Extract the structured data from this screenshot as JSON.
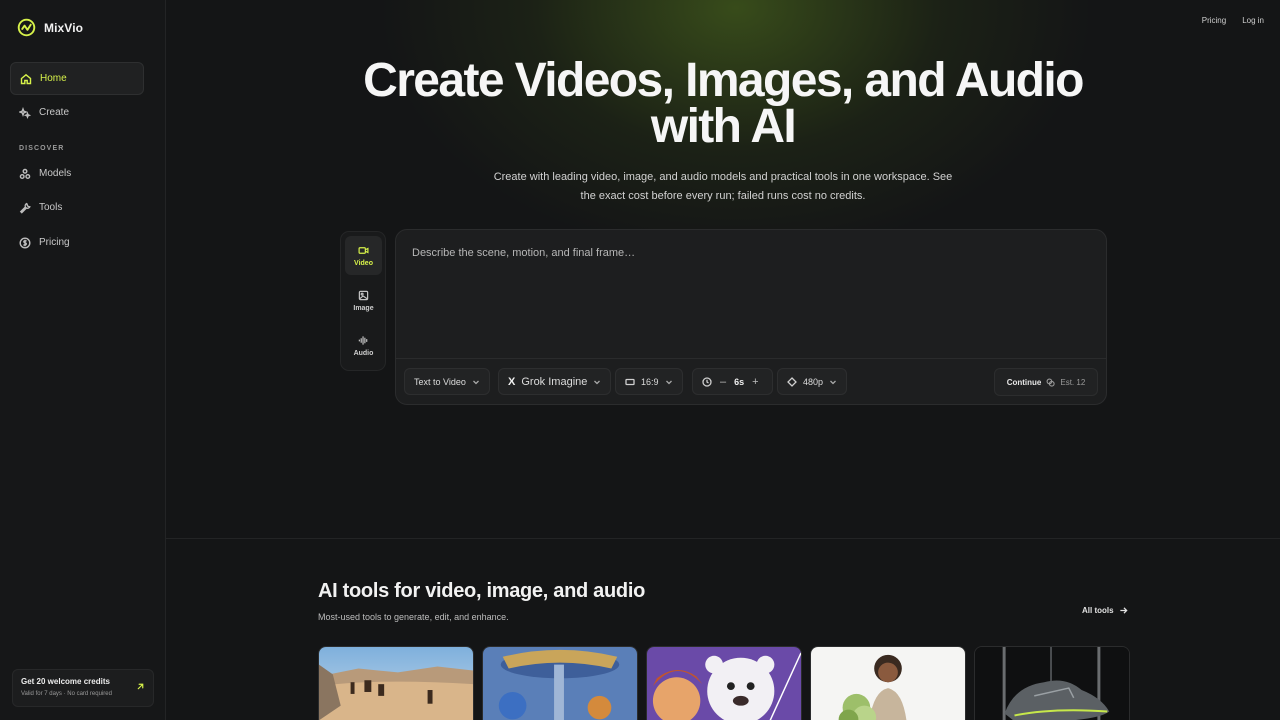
{
  "app": {
    "name": "MixVio",
    "accent": "#d7f24a"
  },
  "sidebar": {
    "items": [
      {
        "label": "Home",
        "icon": "home-icon",
        "active": true
      },
      {
        "label": "Create",
        "icon": "sparkles-icon"
      }
    ],
    "section_label": "DISCOVER",
    "discover_items": [
      {
        "label": "Models",
        "icon": "models-icon"
      },
      {
        "label": "Tools",
        "icon": "wrench-icon"
      },
      {
        "label": "Pricing",
        "icon": "dollar-icon"
      }
    ],
    "promo": {
      "title": "Get 20 welcome credits",
      "subtitle": "Valid for 7 days · No card required",
      "icon": "arrow-up-right-icon"
    }
  },
  "topnav": {
    "pricing": "Pricing",
    "login": "Log in"
  },
  "hero": {
    "title": "Create Videos, Images, and Audio with AI",
    "subtitle": "Create with leading video, image, and audio models and practical tools in one workspace. See the exact cost before every run; failed runs cost no credits."
  },
  "modes": [
    {
      "label": "Video",
      "icon": "video-icon",
      "active": true
    },
    {
      "label": "Image",
      "icon": "image-icon"
    },
    {
      "label": "Audio",
      "icon": "audio-wave-icon"
    }
  ],
  "prompt": {
    "placeholder": "Describe the scene, motion, and final frame…",
    "value": ""
  },
  "toolbar": {
    "mode": "Text to Video",
    "model_mark": "X",
    "model": "Grok Imagine",
    "aspect": "16:9",
    "duration": "6s",
    "duration_minus": "–",
    "duration_plus": "+",
    "resolution": "480p",
    "continue": "Continue",
    "estimate": "Est. 12"
  },
  "tools_section": {
    "title": "AI tools for video, image, and audio",
    "subtitle": "Most-used tools to generate, edit, and enhance.",
    "all_link": "All tools",
    "cards": [
      "desert-caravan-thumbnail",
      "fantasy-carnival-thumbnail",
      "cartoon-bear-thumbnail",
      "woman-with-flowers-thumbnail",
      "sneaker-product-thumbnail"
    ]
  }
}
